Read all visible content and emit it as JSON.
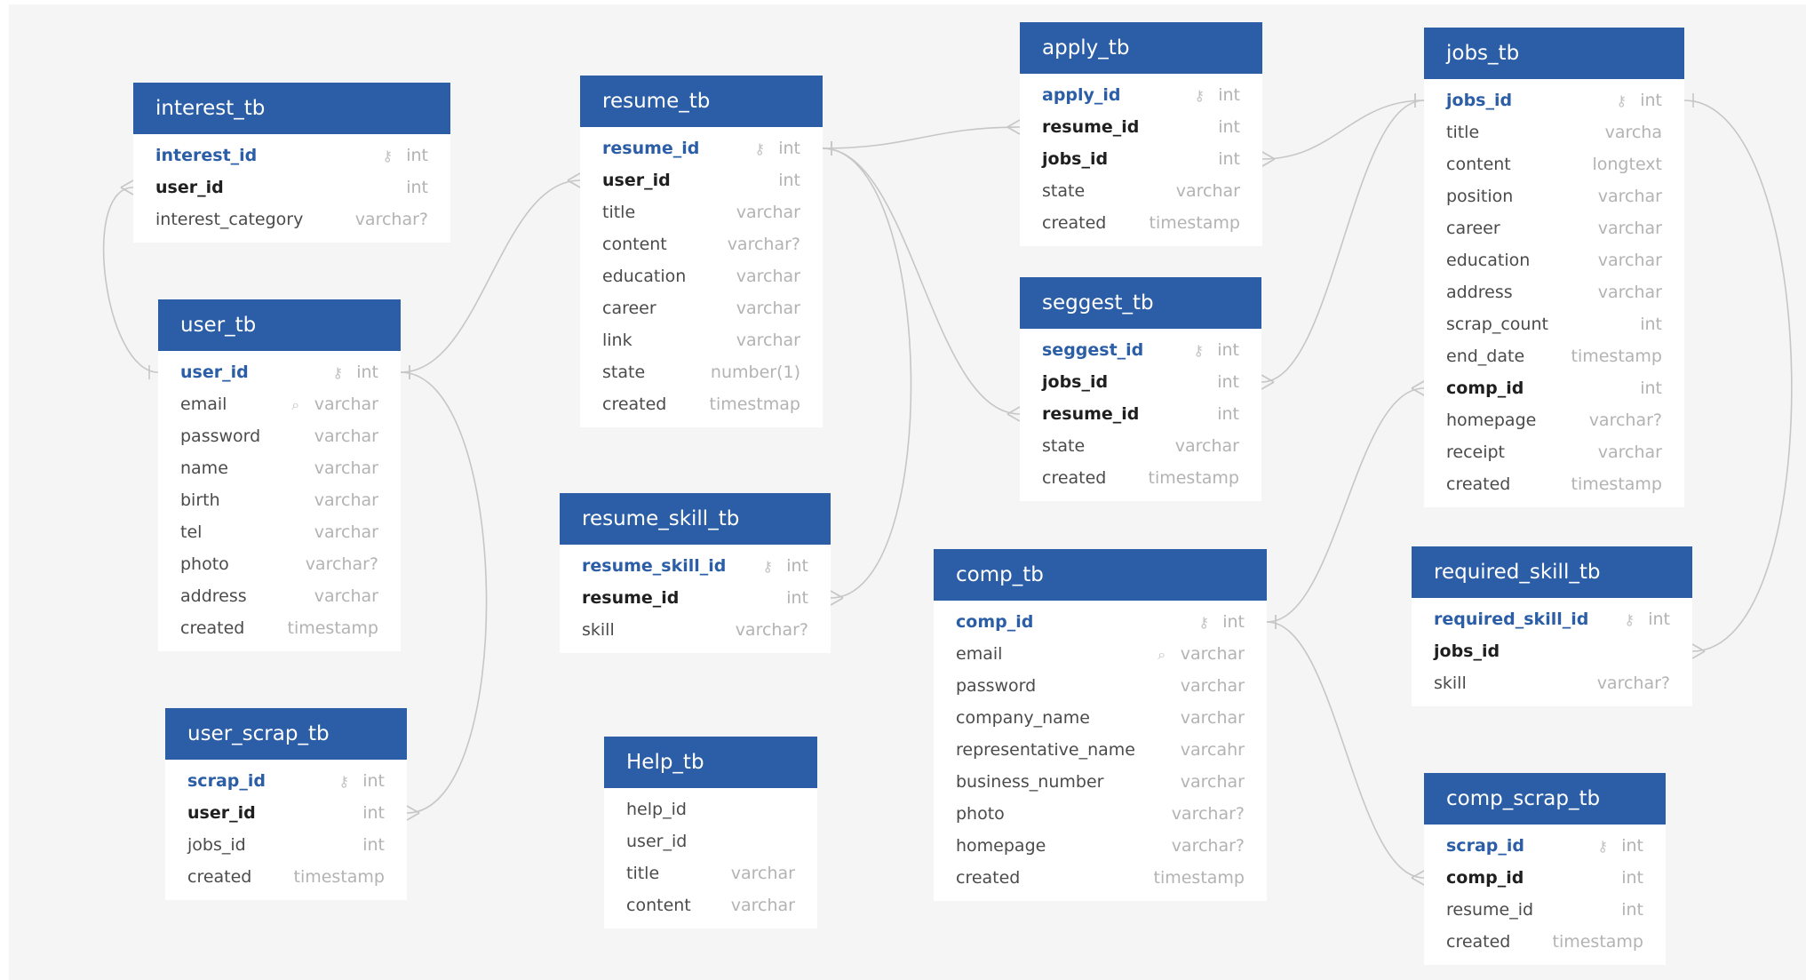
{
  "tables": [
    {
      "id": "interest_tb",
      "name": "interest_tb",
      "fields": [
        {
          "name": "interest_id",
          "type": "int",
          "key": "pk",
          "icon": "key-icon"
        },
        {
          "name": "user_id",
          "type": "int",
          "key": "fk"
        },
        {
          "name": "interest_category",
          "type": "varchar?",
          "key": ""
        }
      ]
    },
    {
      "id": "user_tb",
      "name": "user_tb",
      "fields": [
        {
          "name": "user_id",
          "type": "int",
          "key": "pk",
          "icon": "key-icon"
        },
        {
          "name": "email",
          "type": "varchar",
          "key": "",
          "icon": "search-icon"
        },
        {
          "name": "password",
          "type": "varchar",
          "key": ""
        },
        {
          "name": "name",
          "type": "varchar",
          "key": ""
        },
        {
          "name": "birth",
          "type": "varchar",
          "key": ""
        },
        {
          "name": "tel",
          "type": "varchar",
          "key": ""
        },
        {
          "name": "photo",
          "type": "varchar?",
          "key": ""
        },
        {
          "name": "address",
          "type": "varchar",
          "key": ""
        },
        {
          "name": "created",
          "type": "timestamp",
          "key": ""
        }
      ]
    },
    {
      "id": "user_scrap_tb",
      "name": "user_scrap_tb",
      "fields": [
        {
          "name": "scrap_id",
          "type": "int",
          "key": "pk",
          "icon": "key-icon"
        },
        {
          "name": "user_id",
          "type": "int",
          "key": "fk"
        },
        {
          "name": "jobs_id",
          "type": "int",
          "key": ""
        },
        {
          "name": "created",
          "type": "timestamp",
          "key": ""
        }
      ]
    },
    {
      "id": "resume_tb",
      "name": "resume_tb",
      "fields": [
        {
          "name": "resume_id",
          "type": "int",
          "key": "pk",
          "icon": "key-icon"
        },
        {
          "name": "user_id",
          "type": "int",
          "key": "fk"
        },
        {
          "name": "title",
          "type": "varchar",
          "key": ""
        },
        {
          "name": "content",
          "type": "varchar?",
          "key": ""
        },
        {
          "name": "education",
          "type": "varchar",
          "key": ""
        },
        {
          "name": "career",
          "type": "varchar",
          "key": ""
        },
        {
          "name": "link",
          "type": "varchar",
          "key": ""
        },
        {
          "name": "state",
          "type": "number(1)",
          "key": ""
        },
        {
          "name": "created",
          "type": "timestmap",
          "key": ""
        }
      ]
    },
    {
      "id": "resume_skill_tb",
      "name": "resume_skill_tb",
      "fields": [
        {
          "name": "resume_skill_id",
          "type": "int",
          "key": "pk",
          "icon": "key-icon"
        },
        {
          "name": "resume_id",
          "type": "int",
          "key": "fk"
        },
        {
          "name": "skill",
          "type": "varchar?",
          "key": ""
        }
      ]
    },
    {
      "id": "help_tb",
      "name": "Help_tb",
      "fields": [
        {
          "name": "help_id",
          "type": "",
          "key": ""
        },
        {
          "name": "user_id",
          "type": "",
          "key": ""
        },
        {
          "name": "title",
          "type": "varchar",
          "key": ""
        },
        {
          "name": "content",
          "type": "varchar",
          "key": ""
        }
      ]
    },
    {
      "id": "apply_tb",
      "name": "apply_tb",
      "fields": [
        {
          "name": "apply_id",
          "type": "int",
          "key": "pk",
          "icon": "key-icon"
        },
        {
          "name": "resume_id",
          "type": "int",
          "key": "fk"
        },
        {
          "name": "jobs_id",
          "type": "int",
          "key": "fk"
        },
        {
          "name": "state",
          "type": "varchar",
          "key": ""
        },
        {
          "name": "created",
          "type": "timestamp",
          "key": ""
        }
      ]
    },
    {
      "id": "seggest_tb",
      "name": "seggest_tb",
      "fields": [
        {
          "name": "seggest_id",
          "type": "int",
          "key": "pk",
          "icon": "key-icon"
        },
        {
          "name": "jobs_id",
          "type": "int",
          "key": "fk"
        },
        {
          "name": "resume_id",
          "type": "int",
          "key": "fk"
        },
        {
          "name": "state",
          "type": "varchar",
          "key": ""
        },
        {
          "name": "created",
          "type": "timestamp",
          "key": ""
        }
      ]
    },
    {
      "id": "comp_tb",
      "name": "comp_tb",
      "fields": [
        {
          "name": "comp_id",
          "type": "int",
          "key": "pk",
          "icon": "key-icon"
        },
        {
          "name": "email",
          "type": "varchar",
          "key": "",
          "icon": "search-icon"
        },
        {
          "name": "password",
          "type": "varchar",
          "key": ""
        },
        {
          "name": "company_name",
          "type": "varchar",
          "key": ""
        },
        {
          "name": "representative_name",
          "type": "varcahr",
          "key": ""
        },
        {
          "name": "business_number",
          "type": "varchar",
          "key": ""
        },
        {
          "name": "photo",
          "type": "varchar?",
          "key": ""
        },
        {
          "name": "homepage",
          "type": "varchar?",
          "key": ""
        },
        {
          "name": "created",
          "type": "timestamp",
          "key": ""
        }
      ]
    },
    {
      "id": "jobs_tb",
      "name": "jobs_tb",
      "fields": [
        {
          "name": "jobs_id",
          "type": "int",
          "key": "pk",
          "icon": "key-icon"
        },
        {
          "name": "title",
          "type": "varcha",
          "key": ""
        },
        {
          "name": "content",
          "type": "longtext",
          "key": ""
        },
        {
          "name": "position",
          "type": "varchar",
          "key": ""
        },
        {
          "name": "career",
          "type": "varchar",
          "key": ""
        },
        {
          "name": "education",
          "type": "varchar",
          "key": ""
        },
        {
          "name": "address",
          "type": "varchar",
          "key": ""
        },
        {
          "name": "scrap_count",
          "type": "int",
          "key": ""
        },
        {
          "name": "end_date",
          "type": "timestamp",
          "key": ""
        },
        {
          "name": "comp_id",
          "type": "int",
          "key": "fk"
        },
        {
          "name": "homepage",
          "type": "varchar?",
          "key": ""
        },
        {
          "name": "receipt",
          "type": "varchar",
          "key": ""
        },
        {
          "name": "created",
          "type": "timestamp",
          "key": ""
        }
      ]
    },
    {
      "id": "required_skill_tb",
      "name": "required_skill_tb",
      "fields": [
        {
          "name": "required_skill_id",
          "type": "int",
          "key": "pk",
          "icon": "key-icon"
        },
        {
          "name": "jobs_id",
          "type": "",
          "key": "fk"
        },
        {
          "name": "skill",
          "type": "varchar?",
          "key": ""
        }
      ]
    },
    {
      "id": "comp_scrap_tb",
      "name": "comp_scrap_tb",
      "fields": [
        {
          "name": "scrap_id",
          "type": "int",
          "key": "pk",
          "icon": "key-icon"
        },
        {
          "name": "comp_id",
          "type": "int",
          "key": "fk"
        },
        {
          "name": "resume_id",
          "type": "int",
          "key": ""
        },
        {
          "name": "created",
          "type": "timestamp",
          "key": ""
        }
      ]
    }
  ],
  "relations": [
    {
      "from": "interest_tb.user_id",
      "to": "user_tb.user_id",
      "cardinality": "many-to-one"
    },
    {
      "from": "user_scrap_tb.user_id",
      "to": "user_tb.user_id",
      "cardinality": "many-to-one"
    },
    {
      "from": "resume_tb.user_id",
      "to": "user_tb.user_id",
      "cardinality": "many-to-one"
    },
    {
      "from": "resume_skill_tb.resume_id",
      "to": "resume_tb.resume_id",
      "cardinality": "many-to-one"
    },
    {
      "from": "apply_tb.resume_id",
      "to": "resume_tb.resume_id",
      "cardinality": "many-to-one"
    },
    {
      "from": "seggest_tb.resume_id",
      "to": "resume_tb.resume_id",
      "cardinality": "many-to-one"
    },
    {
      "from": "apply_tb.jobs_id",
      "to": "jobs_tb.jobs_id",
      "cardinality": "many-to-one"
    },
    {
      "from": "seggest_tb.jobs_id",
      "to": "jobs_tb.jobs_id",
      "cardinality": "many-to-one"
    },
    {
      "from": "jobs_tb.comp_id",
      "to": "comp_tb.comp_id",
      "cardinality": "many-to-one"
    },
    {
      "from": "comp_scrap_tb.comp_id",
      "to": "comp_tb.comp_id",
      "cardinality": "many-to-one"
    },
    {
      "from": "required_skill_tb.jobs_id",
      "to": "jobs_tb.jobs_id",
      "cardinality": "many-to-one"
    }
  ],
  "colors": {
    "header": "#2b5ea6",
    "primary_key": "#2b5ea6",
    "type_text": "#b3b3b3",
    "connector": "#c6c6c6",
    "canvas": "#f5f5f6"
  }
}
